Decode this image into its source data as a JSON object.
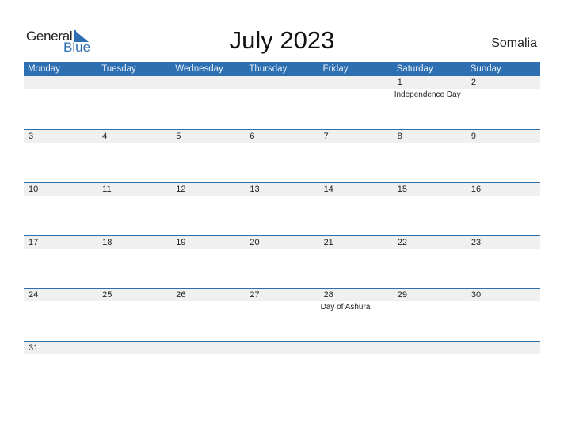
{
  "logo": {
    "general": "General",
    "blue": "Blue",
    "icon": "triangle-flag-icon"
  },
  "title": "July 2023",
  "country": "Somalia",
  "weekdays": [
    "Monday",
    "Tuesday",
    "Wednesday",
    "Thursday",
    "Friday",
    "Saturday",
    "Sunday"
  ],
  "weeks": [
    {
      "days": [
        "",
        "",
        "",
        "",
        "",
        "1",
        "2"
      ],
      "holidays": [
        "",
        "",
        "",
        "",
        "",
        "Independence Day",
        ""
      ]
    },
    {
      "days": [
        "3",
        "4",
        "5",
        "6",
        "7",
        "8",
        "9"
      ],
      "holidays": [
        "",
        "",
        "",
        "",
        "",
        "",
        ""
      ]
    },
    {
      "days": [
        "10",
        "11",
        "12",
        "13",
        "14",
        "15",
        "16"
      ],
      "holidays": [
        "",
        "",
        "",
        "",
        "",
        "",
        ""
      ]
    },
    {
      "days": [
        "17",
        "18",
        "19",
        "20",
        "21",
        "22",
        "23"
      ],
      "holidays": [
        "",
        "",
        "",
        "",
        "",
        "",
        ""
      ]
    },
    {
      "days": [
        "24",
        "25",
        "26",
        "27",
        "28",
        "29",
        "30"
      ],
      "holidays": [
        "",
        "",
        "",
        "",
        "Day of Ashura",
        "",
        ""
      ]
    },
    {
      "days": [
        "31",
        "",
        "",
        "",
        "",
        "",
        ""
      ],
      "holidays": [
        "",
        "",
        "",
        "",
        "",
        "",
        ""
      ]
    }
  ],
  "colors": {
    "accent": "#2e6fb2",
    "strip": "#f0f0f0"
  }
}
